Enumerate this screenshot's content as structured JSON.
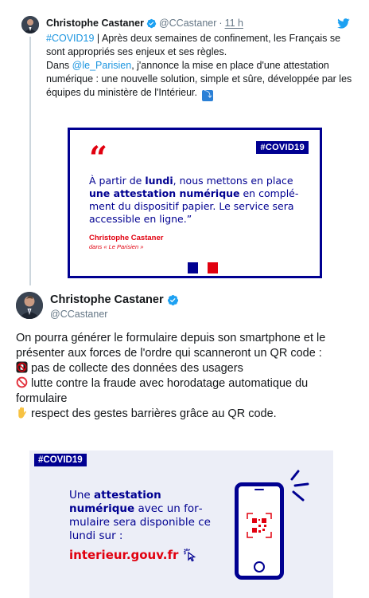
{
  "parent_tweet": {
    "author_name": "Christophe Castaner",
    "author_handle": "@CCastaner",
    "separator": "·",
    "time": "11 h",
    "text_hashtag": "#COVID19",
    "text_part1": " | Après deux semaines de confinement, les Français se sont appropriés ses enjeux et ses règles.",
    "text_part2_prefix": "Dans ",
    "text_mention": "@le_Parisien",
    "text_part2_suffix": ", j'annonce la mise en place d'une attestation numérique : une nouvelle solution, simple et sûre, développée par les équipes du ministère de l'Intérieur.",
    "arrow_glyph": "⤵"
  },
  "quote_card": {
    "tag": "#COVID19",
    "quote_mark": "“",
    "text_a": "À partir de ",
    "text_b_bold": "lundi",
    "text_c": ", nous mettons en place ",
    "text_d_bold": "une attestation numérique",
    "text_e": " en complé­ment du dispositif papier. Le service sera accessible en ligne.”",
    "author": "Christophe Castaner",
    "source": "dans « Le Parisien »"
  },
  "main_tweet": {
    "author_name": "Christophe Castaner",
    "author_handle": "@CCastaner",
    "intro": "On pourra générer le formulaire depuis son smartphone et le présenter aux forces de l'ordre qui scanneront un QR code :",
    "point1": "pas de collecte des données des usagers",
    "point2": "lutte contre la fraude avec horodatage automatique du formulaire",
    "point3": "respect des gestes barrières grâce au QR code."
  },
  "info_card": {
    "tag": "#COVID19",
    "text_a": "Une ",
    "text_b_bold": "attestation numérique",
    "text_c": " avec un for­mulaire sera disponible ce lundi sur :",
    "link": "interieur.gouv.fr"
  },
  "colors": {
    "twitter_blue": "#1da1f2",
    "link_blue": "#1b95e0",
    "marianne_blue": "#000091",
    "marianne_red": "#e1000f",
    "text_primary": "#14171a",
    "text_secondary": "#657786"
  }
}
